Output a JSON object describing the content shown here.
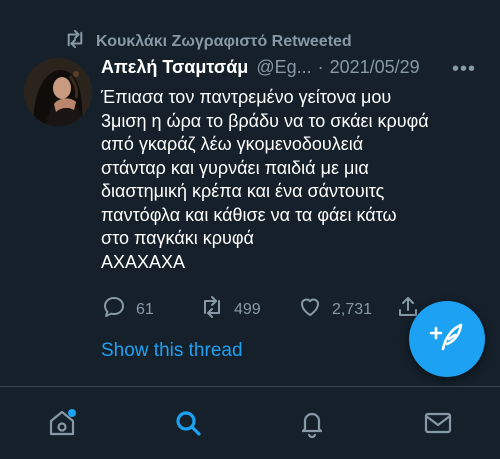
{
  "retweet": {
    "icon": "retweet-icon",
    "text": "Κουκλάκι Ζωγραφιστό Retweeted"
  },
  "tweet": {
    "author_name": "Απελή Τσαμτσάμ",
    "handle": "@Eg...",
    "separator": "·",
    "date": "2021/05/29",
    "more_label": "•••",
    "body_lines": [
      "Έπιασα τον παντρεμένο γείτονα μου",
      "3μιση η ώρα το βράδυ να το σκάει κρυφά",
      "από γκαράζ λέω γκομενοδουλειά",
      "στάνταρ και γυρνάει παιδιά με μια",
      "διαστημική κρέπα και ένα σάντουιτς",
      "παντόφλα και κάθισε να τα φάει κάτω",
      "στο παγκάκι κρυφά",
      "ΑΧΑΧΑΧΑ"
    ],
    "actions": {
      "replies": "61",
      "retweets": "499",
      "likes": "2,731"
    },
    "show_thread": "Show this thread"
  },
  "fab": {
    "icon": "compose-tweet-icon"
  },
  "tabbar": {
    "items": [
      "home-icon",
      "search-icon",
      "notifications-icon",
      "messages-icon"
    ],
    "active": "search-icon"
  },
  "colors": {
    "background": "#15202b",
    "accent": "#1da1f2",
    "secondary_text": "#8899a6",
    "divider": "#38444d"
  }
}
